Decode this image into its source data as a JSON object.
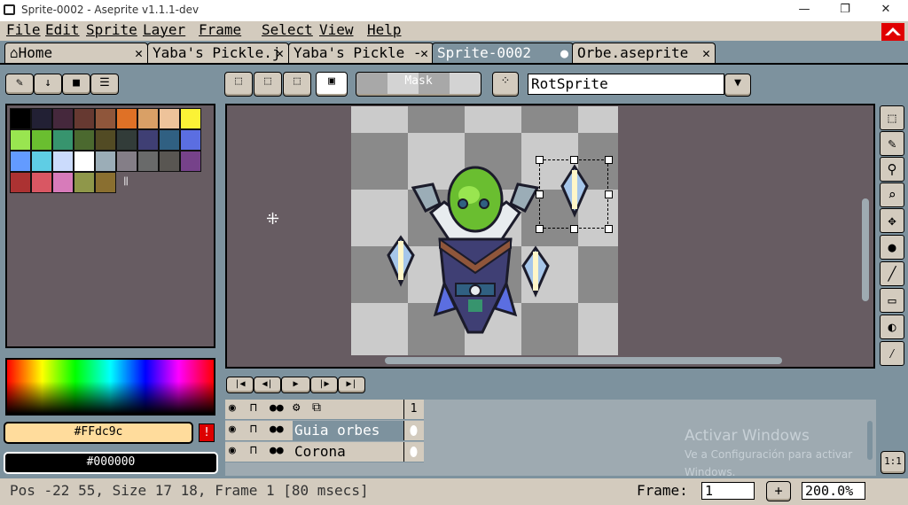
{
  "window": {
    "title": "Sprite-0002 - Aseprite v1.1.1-dev",
    "minimize": "—",
    "maximize": "❐",
    "close": "✕"
  },
  "menu": [
    "File",
    "Edit",
    "Sprite",
    "Layer",
    "Frame",
    "Select",
    "View",
    "Help"
  ],
  "tabs": [
    {
      "label": "Home",
      "close": "✕",
      "active": false
    },
    {
      "label": "Yaba's Pickle.j",
      "close": "✕",
      "active": false
    },
    {
      "label": "Yaba's Pickle -",
      "close": "✕",
      "active": false
    },
    {
      "label": "Sprite-0002",
      "close": "●",
      "active": true
    },
    {
      "label": "Orbe.aseprite",
      "close": "✕",
      "active": false
    }
  ],
  "toolbar": {
    "mask_label": "Mask",
    "rotation_algorithm": "RotSprite"
  },
  "palette": {
    "colors": [
      "#000000",
      "#222034",
      "#45283c",
      "#663931",
      "#8f563b",
      "#df7126",
      "#d9a066",
      "#eec39a",
      "#fbf236",
      "#99e550",
      "#6abe30",
      "#37946e",
      "#4b692f",
      "#524b24",
      "#323c39",
      "#3f3f74",
      "#306082",
      "#5b6ee1",
      "#639bff",
      "#5fcde4",
      "#cbdbfc",
      "#ffffff",
      "#9badb7",
      "#847e87",
      "#696a6a",
      "#595652",
      "#76428a",
      "#ac3232",
      "#d95763",
      "#d77bba",
      "#8f974a",
      "#8a6f30"
    ]
  },
  "colors": {
    "foreground_hex": "#ffdc9c",
    "foreground_label": "#FFdc9c",
    "background_hex": "#000000",
    "background_label": "#000000",
    "warning": "!"
  },
  "timeline": {
    "frame_header": "1",
    "layers": [
      {
        "name": "Guia orbes"
      },
      {
        "name": "Corona"
      }
    ]
  },
  "status": {
    "text": "Pos -22 55, Size 17 18, Frame 1 [80 msecs]",
    "frame_label": "Frame:",
    "frame_value": "1",
    "add_frame": "+",
    "zoom": "200.0%"
  },
  "watermark": {
    "line1": "Activar Windows",
    "line2": "Ve a Configuración para activar",
    "line3": "Windows."
  },
  "zoom_reset": "1:1"
}
